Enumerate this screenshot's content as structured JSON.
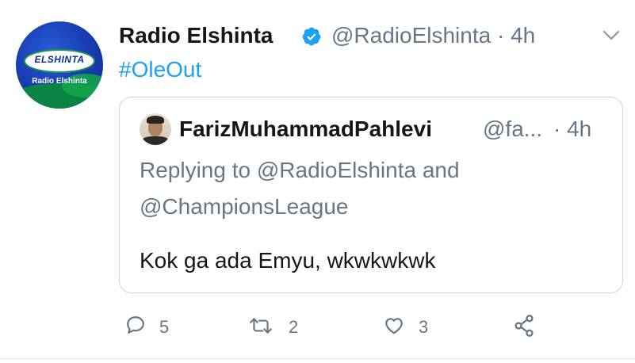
{
  "tweet": {
    "author_name": "Radio Elshinta",
    "author_handle": "@RadioElshinta",
    "time": "· 4h",
    "text": "#OleOut",
    "avatar_logo_text": "ELSHINTA",
    "avatar_logo_sub": "Radio Elshinta",
    "icons": {
      "verified": "verified-badge-icon",
      "more": "chevron-down-icon"
    }
  },
  "quoted": {
    "author_name": "FarizMuhammadPahlevi",
    "author_handle": "@fa...",
    "time": "· 4h",
    "replying_to_line1": "Replying to @RadioElshinta and",
    "replying_to_line2": "@ChampionsLeague",
    "text": "Kok ga ada Emyu, wkwkwkwk"
  },
  "actions": {
    "reply_count": "5",
    "retweet_count": "2",
    "like_count": "3",
    "icons": [
      "reply-icon",
      "retweet-icon",
      "like-icon",
      "share-icon"
    ]
  },
  "colors": {
    "link": "#1da1f2",
    "secondary_text": "#657786",
    "primary_text": "#14171a",
    "border": "#ccd6dd"
  }
}
